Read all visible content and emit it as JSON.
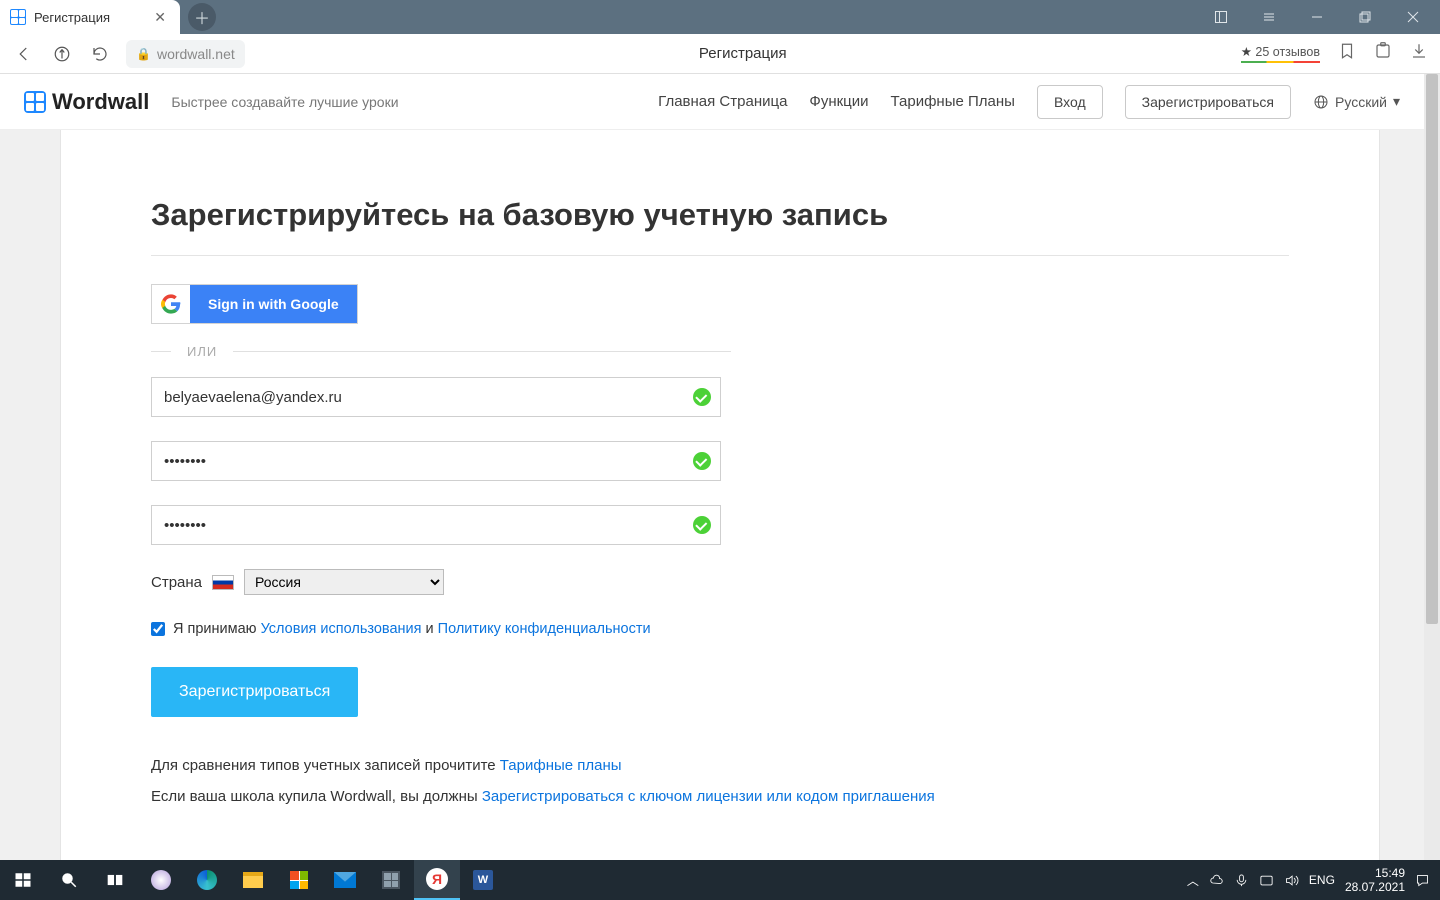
{
  "window": {
    "tab_title": "Регистрация"
  },
  "browser": {
    "url": "wordwall.net",
    "page_title_center": "Регистрация",
    "reviews": "25 отзывов"
  },
  "site_header": {
    "brand": "Wordwall",
    "tagline": "Быстрее создавайте лучшие уроки",
    "nav_home": "Главная Страница",
    "nav_features": "Функции",
    "nav_plans": "Тарифные Планы",
    "login": "Вход",
    "signup": "Зарегистрироваться",
    "language": "Русский"
  },
  "form": {
    "heading": "Зарегистрируйтесь на базовую учетную запись",
    "google_label": "Sign in with Google",
    "or": "ИЛИ",
    "email_value": "belyaevaelena@yandex.ru",
    "password_value": "••••••••",
    "confirm_value": "••••••••",
    "country_label": "Страна",
    "country_value": "Россия",
    "accept_prefix": "Я принимаю",
    "terms_link": "Условия использования",
    "and": "и",
    "privacy_link": "Политику конфиденциальности",
    "submit": "Зарегистрироваться",
    "compare_prefix": "Для сравнения типов учетных записей прочитите",
    "compare_link": "Тарифные планы",
    "school_prefix": "Если ваша школа купила Wordwall, вы должны",
    "school_link": "Зарегистрироваться с ключом лицензии или кодом приглашения"
  },
  "taskbar": {
    "lang": "ENG",
    "time": "15:49",
    "date": "28.07.2021"
  }
}
